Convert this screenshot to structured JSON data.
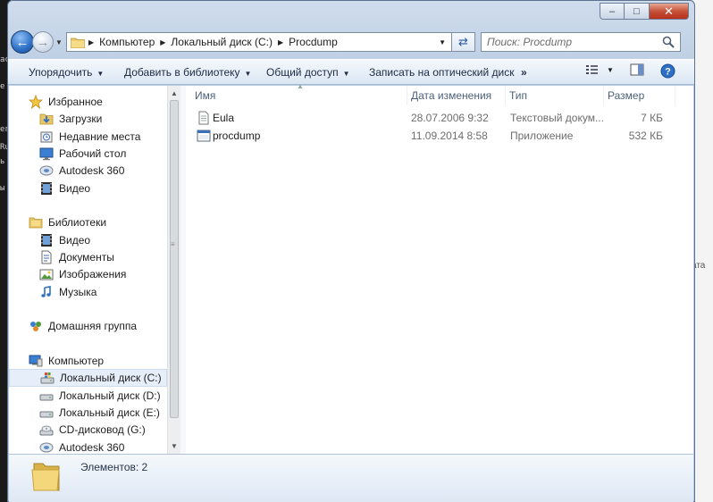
{
  "background": {
    "left_text": [
      "ас",
      "e",
      "ег",
      "Ru",
      "ь",
      "ы"
    ],
    "right_text": "ата"
  },
  "window": {
    "caption": {
      "minimize": "–",
      "maximize": "□",
      "close": "✕"
    }
  },
  "address": {
    "crumbs": [
      "Компьютер",
      "Локальный диск (C:)",
      "Procdump"
    ]
  },
  "search": {
    "placeholder": "Поиск: Procdump"
  },
  "toolbar": {
    "organize": "Упорядочить",
    "add_library": "Добавить в библиотеку",
    "share": "Общий доступ",
    "burn": "Записать на оптический диск",
    "more": "»"
  },
  "nav": {
    "items": [
      {
        "label": "Избранное",
        "icon": "star-icon",
        "level": 0
      },
      {
        "label": "Загрузки",
        "icon": "downloads-icon",
        "level": 1
      },
      {
        "label": "Недавние места",
        "icon": "recent-places-icon",
        "level": 1
      },
      {
        "label": "Рабочий стол",
        "icon": "desktop-icon",
        "level": 1
      },
      {
        "label": "Autodesk 360",
        "icon": "cloud-drive-icon",
        "level": 1
      },
      {
        "label": "Видео",
        "icon": "video-icon",
        "level": 1
      },
      {
        "label": "Библиотеки",
        "icon": "libraries-icon",
        "level": 0
      },
      {
        "label": "Видео",
        "icon": "video-icon",
        "level": 1
      },
      {
        "label": "Документы",
        "icon": "documents-icon",
        "level": 1
      },
      {
        "label": "Изображения",
        "icon": "pictures-icon",
        "level": 1
      },
      {
        "label": "Музыка",
        "icon": "music-icon",
        "level": 1
      },
      {
        "label": "Домашняя группа",
        "icon": "homegroup-icon",
        "level": 0
      },
      {
        "label": "Компьютер",
        "icon": "computer-icon",
        "level": 0
      },
      {
        "label": "Локальный диск (C:)",
        "icon": "system-drive-icon",
        "level": 1,
        "selected": true
      },
      {
        "label": "Локальный диск (D:)",
        "icon": "drive-icon",
        "level": 1
      },
      {
        "label": "Локальный диск (E:)",
        "icon": "drive-icon",
        "level": 1
      },
      {
        "label": "CD-дисковод (G:)",
        "icon": "cd-drive-icon",
        "level": 1
      },
      {
        "label": "Autodesk 360",
        "icon": "cloud-drive-icon",
        "level": 1
      }
    ]
  },
  "columns": {
    "name": "Имя",
    "date": "Дата изменения",
    "type": "Тип",
    "size": "Размер"
  },
  "files": [
    {
      "name": "Eula",
      "date": "28.07.2006 9:32",
      "type": "Текстовый докум...",
      "size": "7 КБ",
      "icon": "text-file-icon"
    },
    {
      "name": "procdump",
      "date": "11.09.2014 8:58",
      "type": "Приложение",
      "size": "532 КБ",
      "icon": "application-icon"
    }
  ],
  "details": {
    "count": "Элементов: 2"
  }
}
